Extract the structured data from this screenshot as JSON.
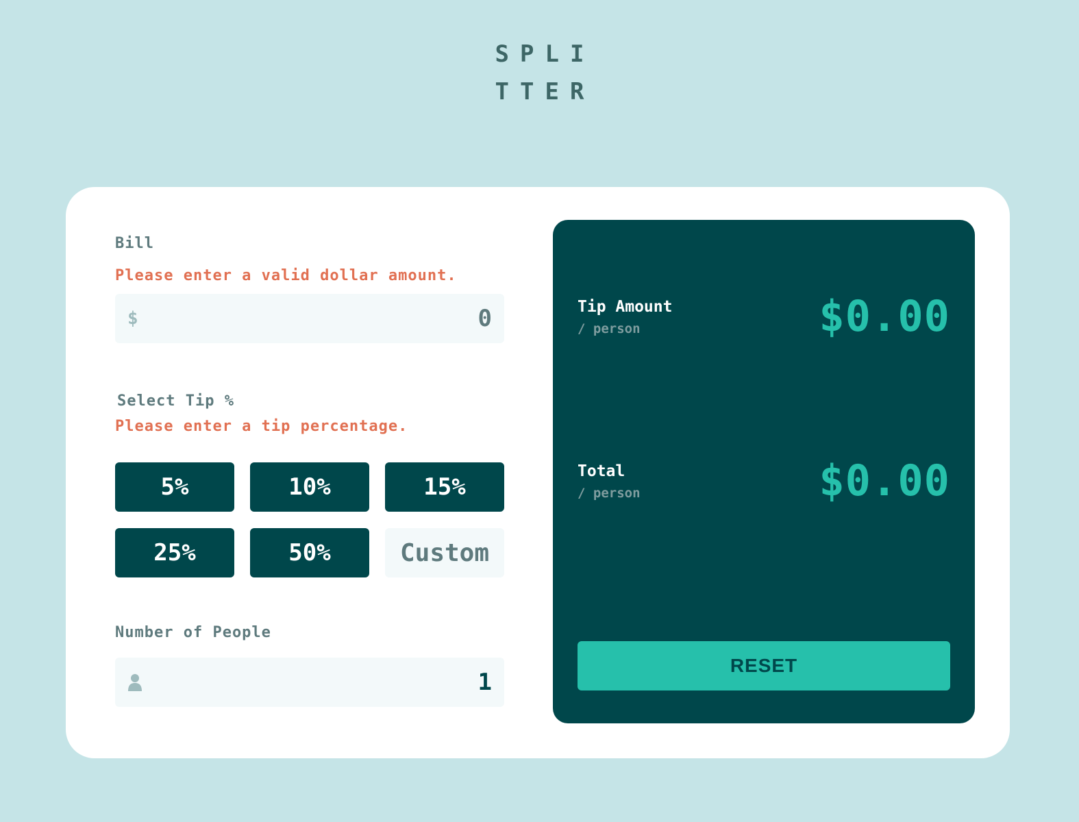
{
  "logo": {
    "line1": "SPLI",
    "line2": "TTER"
  },
  "bill": {
    "label": "Bill",
    "error": "Please enter a valid dollar amount.",
    "prefix_icon": "dollar-icon",
    "prefix": "$",
    "value": "0"
  },
  "tip": {
    "label": "Select Tip %",
    "error": "Please enter a tip percentage.",
    "options": [
      "5%",
      "10%",
      "15%",
      "25%",
      "50%"
    ],
    "custom_placeholder": "Custom"
  },
  "people": {
    "label": "Number of People",
    "icon": "person-icon",
    "value": "1"
  },
  "results": {
    "tip_title": "Tip Amount",
    "tip_sub": "/ person",
    "tip_value": "$0.00",
    "total_title": "Total",
    "total_sub": "/ person",
    "total_value": "$0.00",
    "reset_label": "RESET"
  },
  "colors": {
    "background": "#c5e4e7",
    "dark_cyan": "#00474b",
    "accent": "#26c0ab",
    "error": "#e17052",
    "label": "#5e7a7d"
  }
}
